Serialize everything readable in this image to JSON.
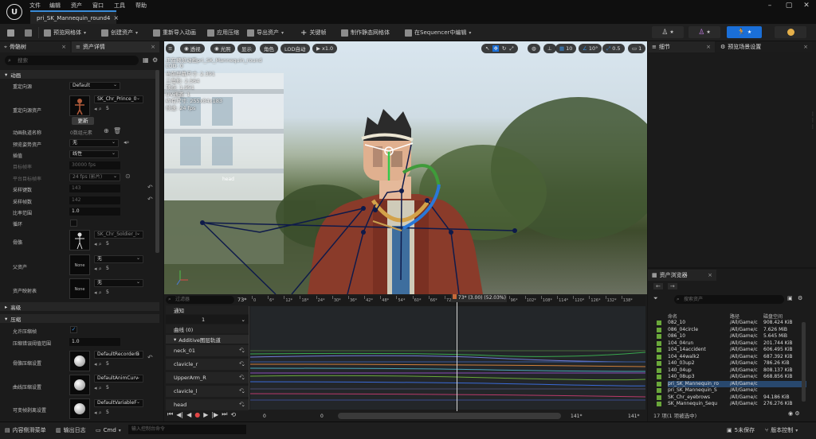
{
  "menubar": {
    "items": [
      "文件",
      "编辑",
      "资产",
      "窗口",
      "工具",
      "帮助"
    ],
    "doc_tab": "pri_SK_Mannequin_round4"
  },
  "toolbar": {
    "preview_mesh": "预览网格体",
    "create_asset": "创建资产",
    "reimport_animation": "重新导入动画",
    "apply_compression": "应用压缩",
    "export_asset": "导出资产",
    "keyframe": "关键帧",
    "make_static_mesh": "制作静态网格体",
    "edit_in_sequencer": "在Sequencer中编辑"
  },
  "left_panel": {
    "tabs": [
      "骨骼树",
      "资产详情"
    ],
    "search_placeholder": "搜索",
    "sections": {
      "animation": "动画",
      "advanced": "高级",
      "compression": "压缩"
    },
    "props": {
      "retarget_source_label": "重定向源",
      "retarget_source_value": "Default",
      "retarget_asset_label": "重定向源资产",
      "retarget_asset_value": "SK_Chr_Prince_0",
      "update_button": "更新",
      "anim_track_names_label": "动画轨道名称",
      "anim_track_names_value": "0数组元素",
      "preview_pose_label": "预览姿势资产",
      "preview_pose_value": "无",
      "interpolation_label": "插值",
      "interpolation_value": "线性",
      "target_frame_rate_label": "目标帧率",
      "target_frame_rate_value": "30000 fps",
      "platform_frame_rate_label": "平台目标帧率",
      "platform_frame_rate_value": "24 fps (影片)",
      "sampled_keys_label": "采样键数",
      "sampled_keys_value": "143",
      "sampled_frames_label": "采样帧数",
      "sampled_frames_value": "142",
      "rate_scale_label": "比率范围",
      "rate_scale_value": "1.0",
      "loop_label": "循环",
      "skeleton_label": "骨骼",
      "skeleton_value": "SK_Chr_Soldier_I",
      "parent_asset_label": "父资产",
      "parent_asset_value": "无",
      "none_thumb": "None",
      "asset_mapping_label": "资产映射表",
      "asset_mapping_value": "无",
      "allow_compression_label": "允许压缩帧",
      "compression_error_label": "压缩错误阈值范围",
      "compression_error_value": "1.0",
      "bone_compression_label": "骨骼压缩设置",
      "bone_compression_value": "DefaultRecorderB",
      "curve_compression_label": "曲线压缩设置",
      "curve_compression_value": "DefaultAnimCurv",
      "variable_frame_label": "可变帧剥离设置",
      "variable_frame_value": "DefaultVariableF",
      "index_badge": "5"
    }
  },
  "viewport": {
    "buttons": {
      "perspective": "透视",
      "lit": "光照",
      "show": "显示",
      "character": "角色",
      "lod": "LOD自动",
      "speed": "x1.0"
    },
    "right_controls": {
      "grid": "10",
      "angle": "10°",
      "scale": "0.5",
      "cam": "1"
    },
    "stats": [
      "正在预览动画pri_SK_Mannequin_round",
      "LOD: 0",
      "当前屏幕尺寸: 2.391",
      "三角形: 2,564",
      "顶点: 1,951",
      "UV通道: 1",
      "约有尺寸: 255x84x183",
      "帧速: 24 fps"
    ],
    "bone_label": "head"
  },
  "timeline": {
    "filter_placeholder": "过滤器",
    "frame_count": "73*",
    "notifies": "通知",
    "notify_track": "1",
    "curves": "曲线 (0)",
    "additive": "Additive图层轨道",
    "tracks": [
      "neck_01",
      "clavicle_r",
      "UpperArm_R",
      "clavicle_l",
      "head"
    ],
    "playhead": "73* (3.00) (52.03%)",
    "ruler_ticks": [
      "0",
      "6*",
      "12*",
      "18*",
      "24*",
      "30*",
      "36*",
      "42*",
      "48*",
      "54*",
      "60*",
      "66*",
      "72*",
      "78*",
      "84*",
      "90*",
      "96*",
      "102*",
      "108*",
      "114*",
      "120*",
      "126*",
      "132*",
      "138*"
    ],
    "start_frame": "0",
    "start_frame_b": "0",
    "end_frame": "141*",
    "end_frame_b": "141*"
  },
  "details_panel": {
    "tabs": [
      "细节",
      "预览场景设置"
    ]
  },
  "asset_browser": {
    "title": "资产浏览器",
    "search_placeholder": "搜索资产",
    "columns": [
      "命名",
      "路径",
      "磁盘空间"
    ],
    "rows": [
      {
        "name": "082_10",
        "path": "/All/Game/c",
        "size": "908.424 KiB"
      },
      {
        "name": "086_04circle",
        "path": "/All/Game/c",
        "size": "7.626 MiB"
      },
      {
        "name": "086_10",
        "path": "/All/Game/c",
        "size": "5.645 MiB"
      },
      {
        "name": "104_04run",
        "path": "/All/Game/c",
        "size": "201.744 KiB"
      },
      {
        "name": "104_14accident",
        "path": "/All/Game/c",
        "size": "606.495 KiB"
      },
      {
        "name": "104_44walk2",
        "path": "/All/Game/c",
        "size": "687.392 KiB"
      },
      {
        "name": "140_03up2",
        "path": "/All/Game/c",
        "size": "786.26 KiB"
      },
      {
        "name": "140_04up",
        "path": "/All/Game/c",
        "size": "808.137 KiB"
      },
      {
        "name": "140_08up3",
        "path": "/All/Game/c",
        "size": "668.856 KiB"
      },
      {
        "name": "pri_SK_Mannequin_ro",
        "path": "/All/Game/c",
        "size": ""
      },
      {
        "name": "pri_SK_Mannequin_S",
        "path": "/All/Game/c",
        "size": ""
      },
      {
        "name": "SK_Chr_eyebrows",
        "path": "/All/Game/c",
        "size": "94.186 KiB"
      },
      {
        "name": "SK_Mannequin_Sequ",
        "path": "/All/Game/c",
        "size": "276.276 KiB"
      }
    ],
    "footer": "17 项(1 项被选中)"
  },
  "statusbar": {
    "content_drawer": "内容侧滑菜单",
    "output_log": "输出日志",
    "cmd": "Cmd",
    "console_placeholder": "输入控制台命令",
    "unsaved": "5未保存",
    "source_control": "版本控制"
  },
  "colors": {
    "accent": "#1a6fd8",
    "playhead": "#d0d0d0",
    "selected_row": "#28486e"
  }
}
